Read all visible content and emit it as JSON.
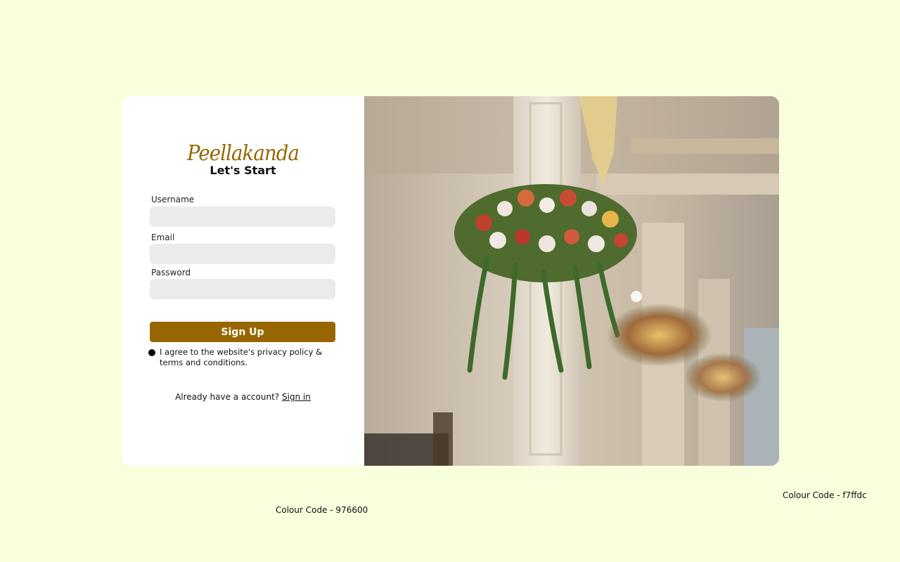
{
  "brand": {
    "logo": "Peellakanda",
    "subtitle": "Let's Start"
  },
  "form": {
    "username_label": "Username",
    "username_value": "",
    "email_label": "Email",
    "email_value": "",
    "password_label": "Password",
    "password_value": "",
    "signup_label": "Sign Up",
    "agree_text": "I agree to the website's privacy policy & terms and conditions.",
    "signin_prompt": "Already have a account?",
    "signin_link": "Sign in"
  },
  "notes": {
    "accent_colour": "Colour Code - 976600",
    "background_colour": "Colour Code - f7ffdc"
  },
  "colors": {
    "accent": "#976600",
    "background": "#f7ffdc",
    "input": "#ebebeb"
  }
}
